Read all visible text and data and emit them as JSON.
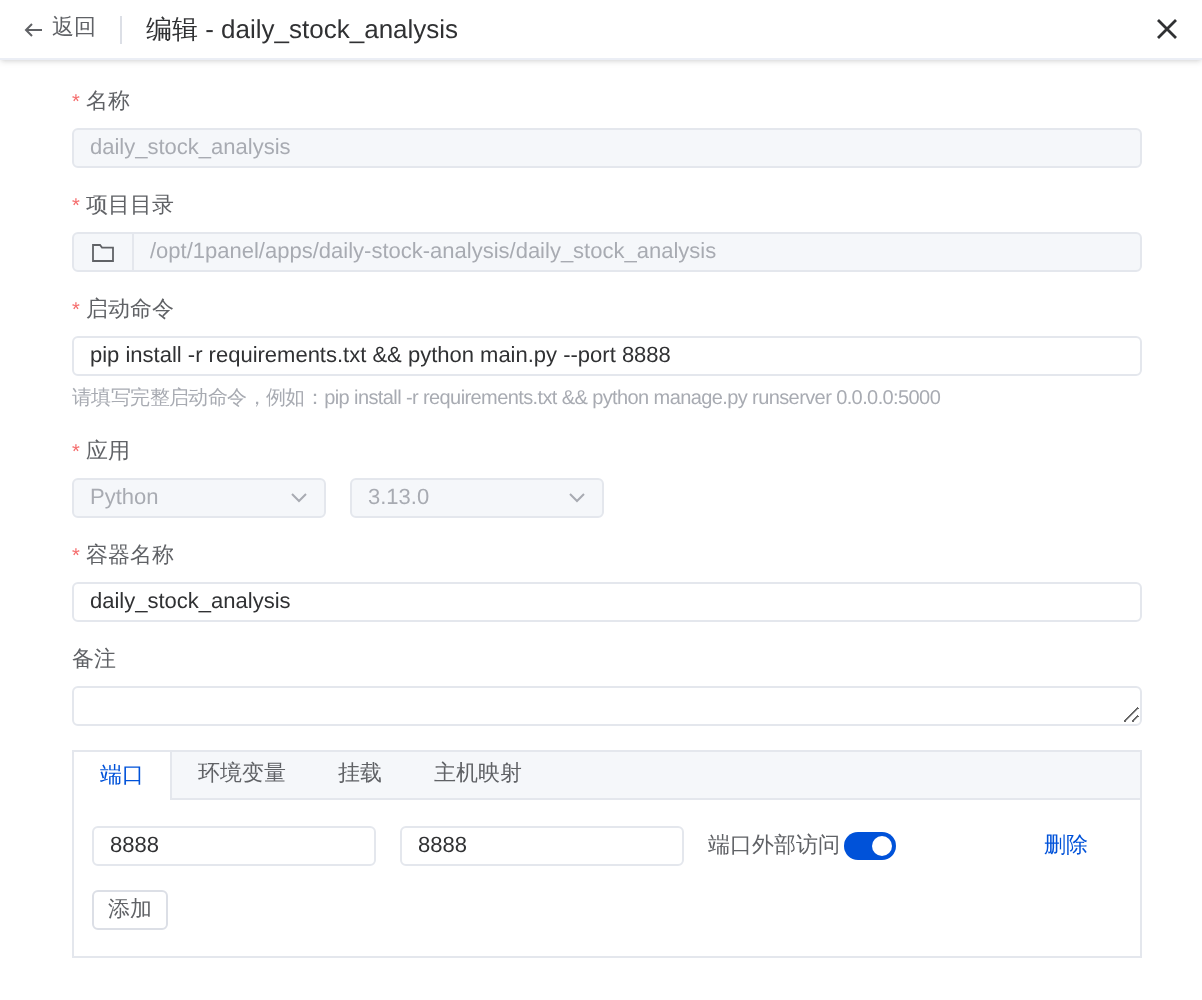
{
  "header": {
    "back_label": "返回",
    "title": "编辑 - daily_stock_analysis"
  },
  "fields": [
    {
      "kind": "text",
      "label": "名称",
      "required_mark": "*",
      "value": "daily_stock_analysis",
      "disabled": true
    },
    {
      "kind": "path",
      "label": "项目目录",
      "required_mark": "*",
      "value": "/opt/1panel/apps/daily-stock-analysis/daily_stock_analysis",
      "disabled": true
    },
    {
      "kind": "text",
      "label": "启动命令",
      "required_mark": "*",
      "value": "pip install -r requirements.txt && python main.py --port 8888",
      "disabled": false,
      "hint": "请填写完整启动命令，例如：pip install -r requirements.txt && python manage.py runserver 0.0.0.0:5000"
    },
    {
      "kind": "selects",
      "label": "应用",
      "required_mark": "*",
      "values": [
        "Python",
        "3.13.0"
      ],
      "disabled": true
    },
    {
      "kind": "text",
      "label": "容器名称",
      "required_mark": "*",
      "value": "daily_stock_analysis",
      "disabled": false
    },
    {
      "kind": "textarea",
      "label": "备注"
    }
  ],
  "tabs": [
    {
      "label": "端口",
      "selected": true
    },
    {
      "label": "环境变量",
      "selected": false
    },
    {
      "label": "挂载",
      "selected": false
    },
    {
      "label": "主机映射",
      "selected": false
    }
  ],
  "ports": [
    {
      "host_port": "8888",
      "container_port": "8888",
      "external_label": "端口外部访问",
      "external_access": true,
      "delete_label": "删除"
    }
  ],
  "add_button": "添加"
}
